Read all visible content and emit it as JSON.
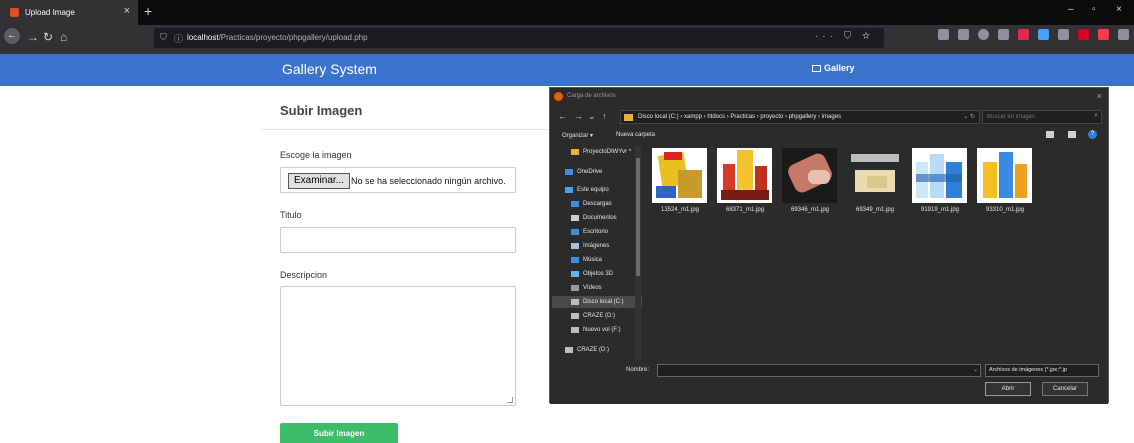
{
  "browser": {
    "tab_title": "Upload Image",
    "tab_close": "×",
    "new_tab": "+",
    "url_host": "localhost",
    "url_path": "/Practicas/proyecto/phpgallery/upload.php",
    "page_actions": "··· ⛉ ☆",
    "window_controls": [
      "–",
      "▫",
      "×"
    ]
  },
  "site": {
    "brand": "Gallery System",
    "nav_gallery": "Gallery"
  },
  "form": {
    "title": "Subir Imagen",
    "file_label": "Escoge la imagen",
    "file_button": "Examinar...",
    "file_status": "No se ha seleccionado ningún archivo.",
    "title_label": "Titulo",
    "title_value": "",
    "description_label": "Descripcion",
    "description_value": "",
    "submit_label": "Subir Imagen",
    "accent": "#3dbd6a",
    "header_color": "#3a73cb"
  },
  "dialog": {
    "title": "Carga de archivos",
    "close": "×",
    "breadcrumb": "Disco local (C:) › xampp › htdocs › Practicas › proyecto › phpgallery › images",
    "search_placeholder": "Buscar en images",
    "organize": "Organizar ▾",
    "new_folder": "Nueva carpeta",
    "nav_items": [
      {
        "label": "ProyectoDIWYvr ^",
        "icon": "folder-icon"
      },
      {
        "label": "OneDrive",
        "icon": "cloud-icon"
      },
      {
        "label": "Este equipo",
        "icon": "computer-icon"
      },
      {
        "label": "Descargas",
        "icon": "download-icon"
      },
      {
        "label": "Documentos",
        "icon": "document-icon"
      },
      {
        "label": "Escritorio",
        "icon": "desktop-icon"
      },
      {
        "label": "Imágenes",
        "icon": "pictures-icon"
      },
      {
        "label": "Música",
        "icon": "music-icon"
      },
      {
        "label": "Objetos 3D",
        "icon": "cube-icon"
      },
      {
        "label": "Vídeos",
        "icon": "video-icon"
      },
      {
        "label": "Disco local (C:)",
        "icon": "drive-icon"
      },
      {
        "label": "CRAZE (D:)",
        "icon": "drive-icon"
      },
      {
        "label": "Nuevo vol (F:)",
        "icon": "drive-icon"
      },
      {
        "label": "CRAZE (D:)",
        "icon": "drive-icon"
      }
    ],
    "files": [
      {
        "name": "13524_m1.jpg"
      },
      {
        "name": "68371_m1.jpg"
      },
      {
        "name": "69346_m1.jpg"
      },
      {
        "name": "69349_m1.jpg"
      },
      {
        "name": "91919_m1.jpg"
      },
      {
        "name": "93310_m1.jpg"
      }
    ],
    "name_label": "Nombre:",
    "name_value": "",
    "filter": "Archivos de imágenes (*.jpe;*.jp",
    "open_button": "Abrir",
    "cancel_button": "Cancelar"
  }
}
